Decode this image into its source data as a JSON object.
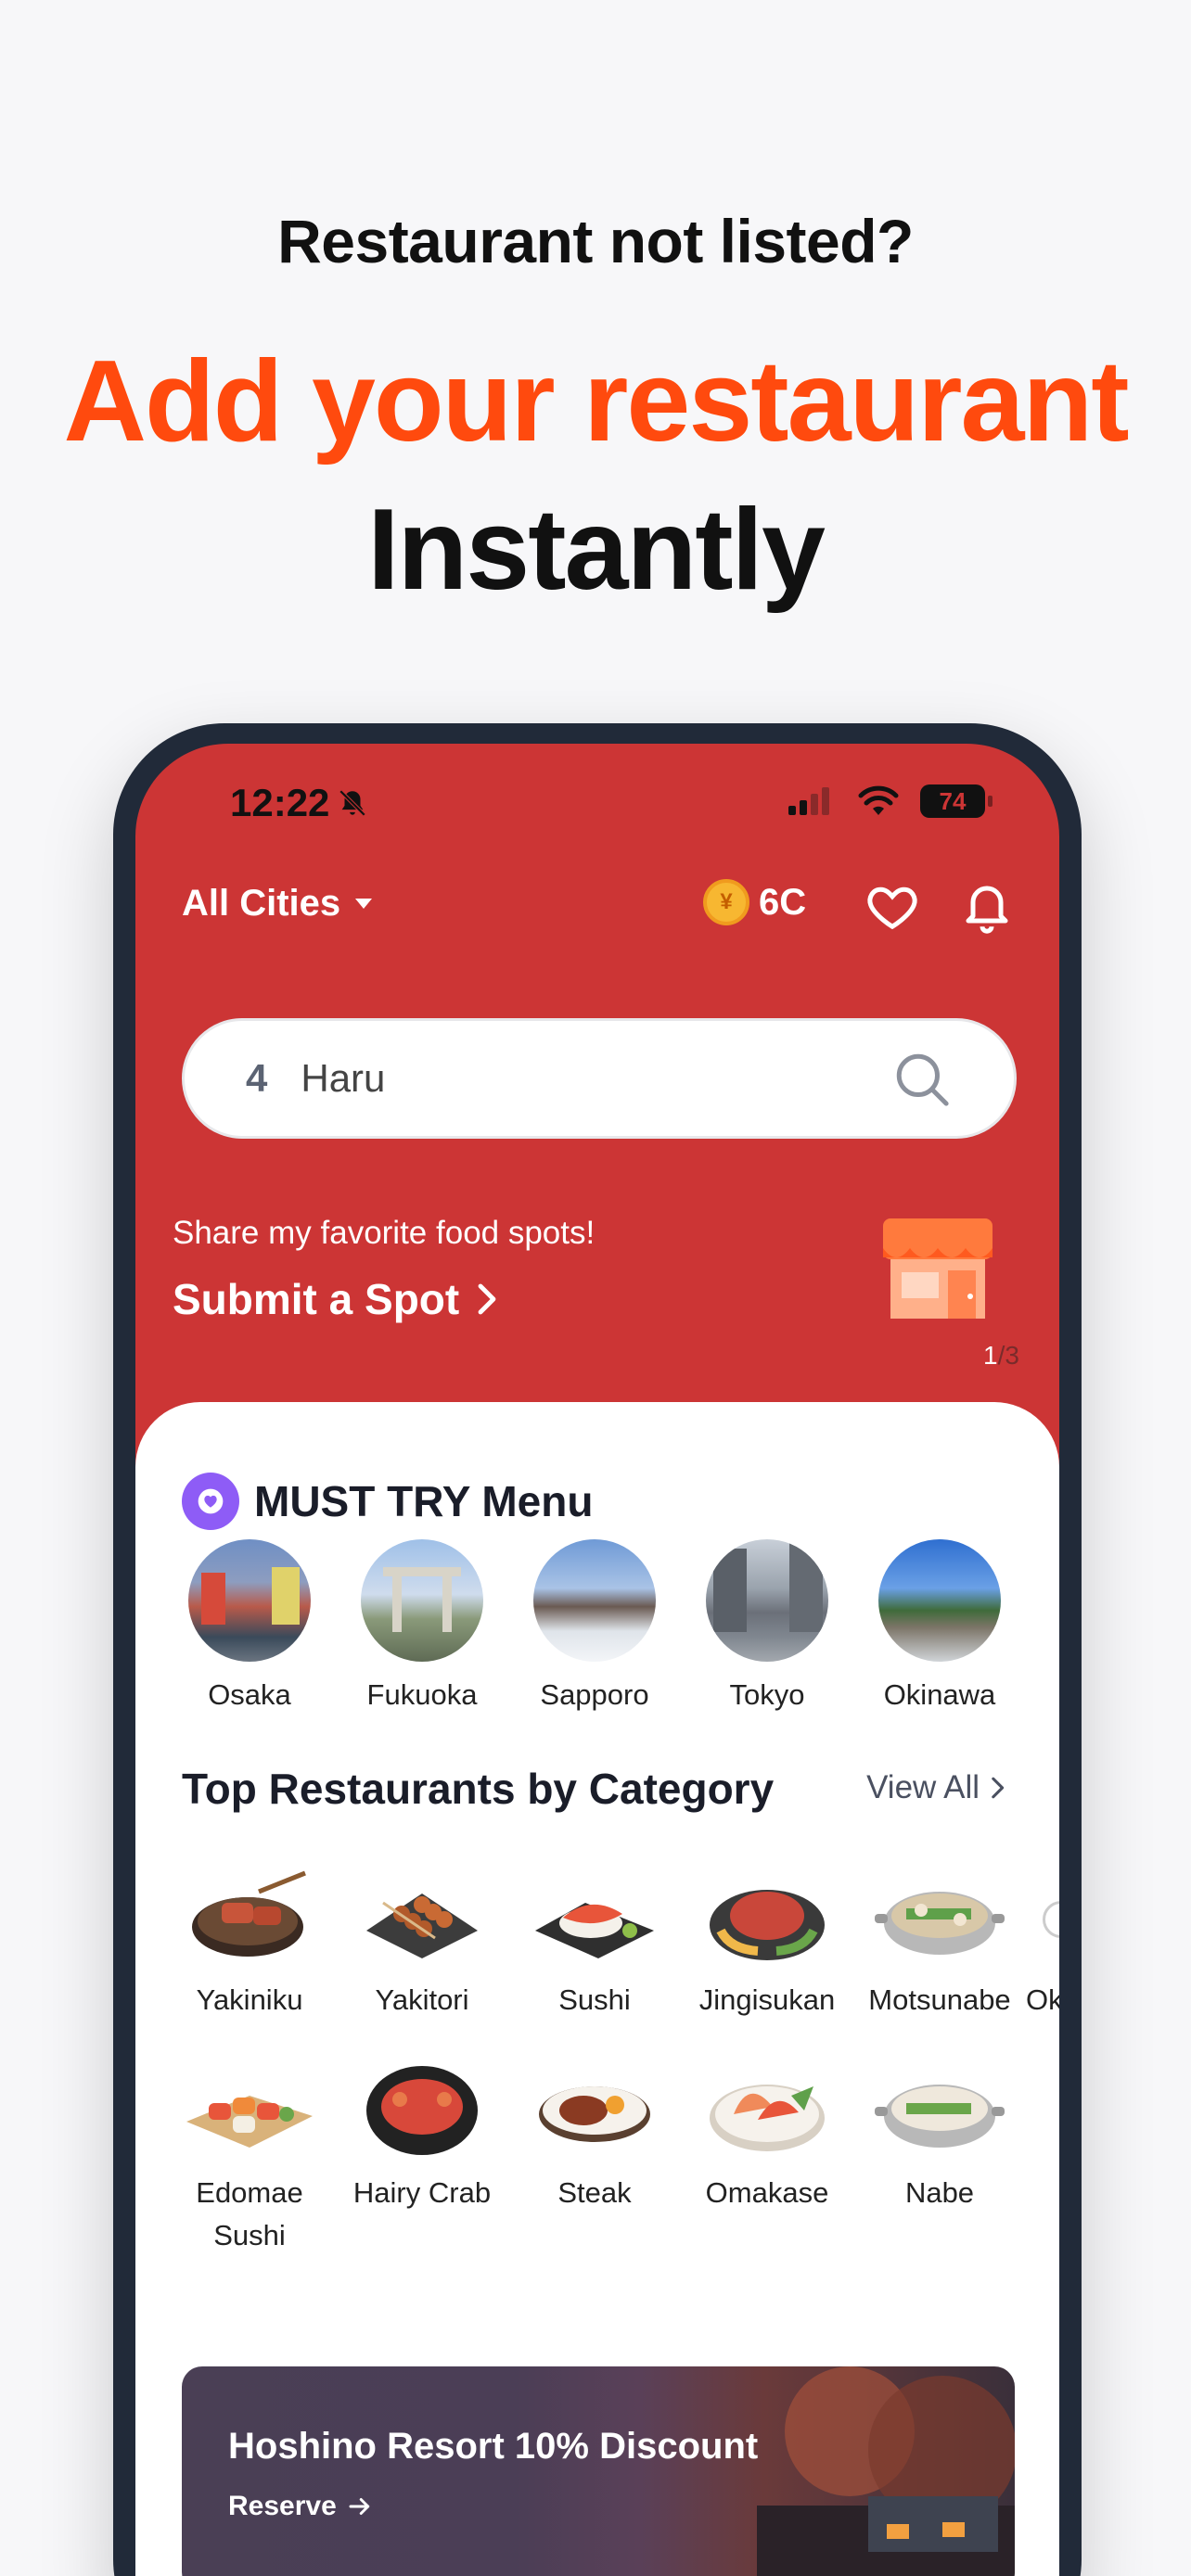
{
  "promo": {
    "line1": "Restaurant not listed?",
    "line2": "Add your restaurant",
    "line3": "Instantly",
    "accent_color": "#ff4a0e"
  },
  "status_bar": {
    "time": "12:22",
    "battery": "74",
    "icons": [
      "bell-slash-icon",
      "signal-icon",
      "wifi-icon",
      "battery-icon"
    ]
  },
  "header": {
    "city_selector": "All Cities",
    "coins": "6C",
    "icons": [
      "coin-icon",
      "heart-icon",
      "bell-icon"
    ],
    "brand_color": "#cc3535"
  },
  "search": {
    "rank": "4",
    "value": "Haru"
  },
  "banner": {
    "subtitle": "Share my favorite food spots!",
    "title": "Submit a Spot",
    "page_current": "1",
    "page_total": "/3"
  },
  "must_try": {
    "title": "MUST TRY Menu",
    "cities": [
      {
        "label": "Osaka"
      },
      {
        "label": "Fukuoka"
      },
      {
        "label": "Sapporo"
      },
      {
        "label": "Tokyo"
      },
      {
        "label": "Okinawa"
      }
    ]
  },
  "categories": {
    "title": "Top Restaurants by Category",
    "view_all": "View All",
    "row1": [
      {
        "label": "Yakiniku"
      },
      {
        "label": "Yakitori"
      },
      {
        "label": "Sushi"
      },
      {
        "label": "Jingisukan"
      },
      {
        "label": "Motsunabe"
      },
      {
        "label": "Ok"
      }
    ],
    "row2": [
      {
        "label": "Edomae\nSushi"
      },
      {
        "label": "Hairy Crab"
      },
      {
        "label": "Steak"
      },
      {
        "label": "Omakase"
      },
      {
        "label": "Nabe"
      }
    ]
  },
  "resort_banner": {
    "title": "Hoshino Resort 10% Discount",
    "cta": "Reserve"
  }
}
